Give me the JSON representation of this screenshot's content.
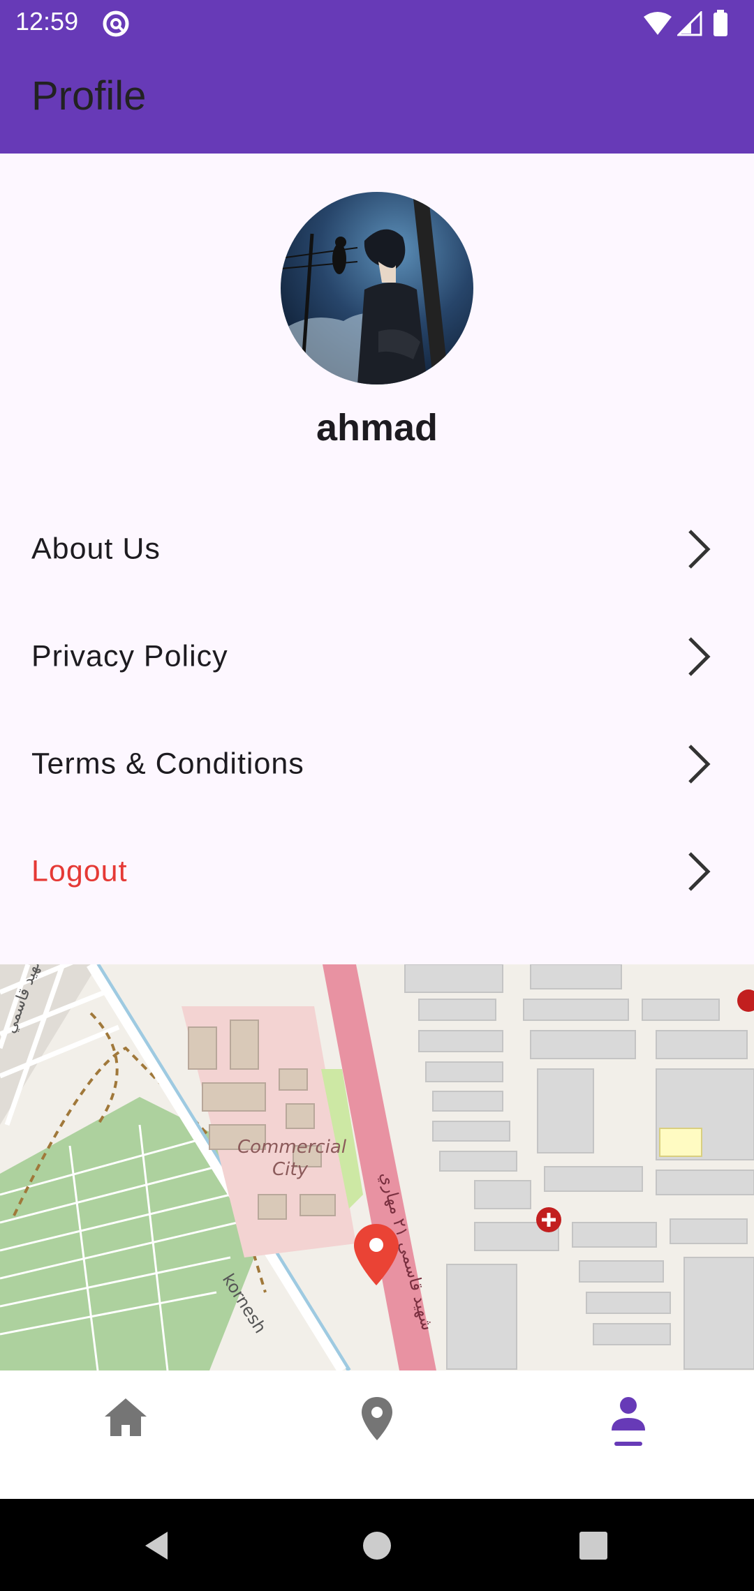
{
  "status_bar": {
    "time": "12:59"
  },
  "app_bar": {
    "title": "Profile"
  },
  "profile": {
    "username": "ahmad"
  },
  "menu": [
    {
      "label": "About Us",
      "color": "#1d1b20"
    },
    {
      "label": "Privacy Policy",
      "color": "#1d1b20"
    },
    {
      "label": "Terms & Conditions",
      "color": "#1d1b20"
    },
    {
      "label": "Logout",
      "color": "#e53935"
    }
  ],
  "map": {
    "labels": {
      "area": "Commercial",
      "area2": "City",
      "road1": "kornesh",
      "road2": "شهيد قاسمي ٢١ مهاري",
      "road3": "شهيد قاسمي"
    }
  },
  "bottom_nav": [
    {
      "icon": "home-icon",
      "active": false
    },
    {
      "icon": "location-pin-icon",
      "active": false
    },
    {
      "icon": "person-icon",
      "active": true
    }
  ],
  "colors": {
    "primary": "#673ab7",
    "active_nav": "#673ab7",
    "logout": "#e53935",
    "pin": "#ea4335"
  }
}
